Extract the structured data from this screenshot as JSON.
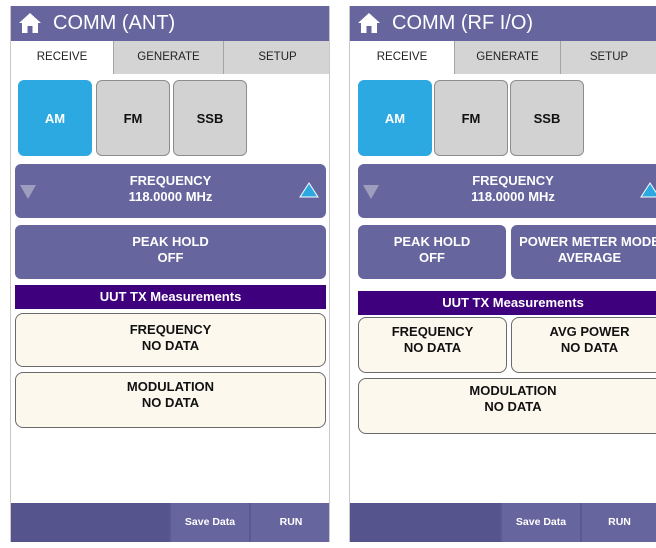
{
  "colors": {
    "header": "#67659e",
    "active_mode": "#2ca9e1",
    "section_bar": "#3f007d",
    "measurement_bg": "#fdf8ee",
    "up_arrow": "#2ca9e1"
  },
  "icons": {
    "home": "home-icon",
    "down": "triangle-down-icon",
    "up": "triangle-up-icon"
  },
  "left": {
    "title": "COMM (ANT)",
    "tabs": [
      "RECEIVE",
      "GENERATE",
      "SETUP"
    ],
    "active_tab": "RECEIVE",
    "modes": [
      "AM",
      "FM",
      "SSB"
    ],
    "active_mode": "AM",
    "frequency": {
      "label": "FREQUENCY",
      "value": "118.0000 MHz"
    },
    "peak_hold": {
      "label": "PEAK HOLD",
      "value": "OFF"
    },
    "section_title": "UUT TX Measurements",
    "measurements": [
      {
        "label": "FREQUENCY",
        "value": "NO DATA"
      },
      {
        "label": "MODULATION",
        "value": "NO DATA"
      }
    ],
    "bottom": {
      "save": "Save Data",
      "run": "RUN"
    }
  },
  "right": {
    "title": "COMM (RF I/O)",
    "tabs": [
      "RECEIVE",
      "GENERATE",
      "SETUP"
    ],
    "active_tab": "RECEIVE",
    "modes": [
      "AM",
      "FM",
      "SSB"
    ],
    "active_mode": "AM",
    "frequency": {
      "label": "FREQUENCY",
      "value": "118.0000 MHz"
    },
    "peak_hold": {
      "label": "PEAK HOLD",
      "value": "OFF"
    },
    "power_meter_mode": {
      "label": "POWER METER MODE",
      "value": "AVERAGE"
    },
    "section_title": "UUT TX Measurements",
    "measurements": [
      {
        "label": "FREQUENCY",
        "value": "NO DATA"
      },
      {
        "label": "AVG POWER",
        "value": "NO DATA"
      },
      {
        "label": "MODULATION",
        "value": "NO DATA"
      }
    ],
    "bottom": {
      "save": "Save Data",
      "run": "RUN"
    }
  }
}
